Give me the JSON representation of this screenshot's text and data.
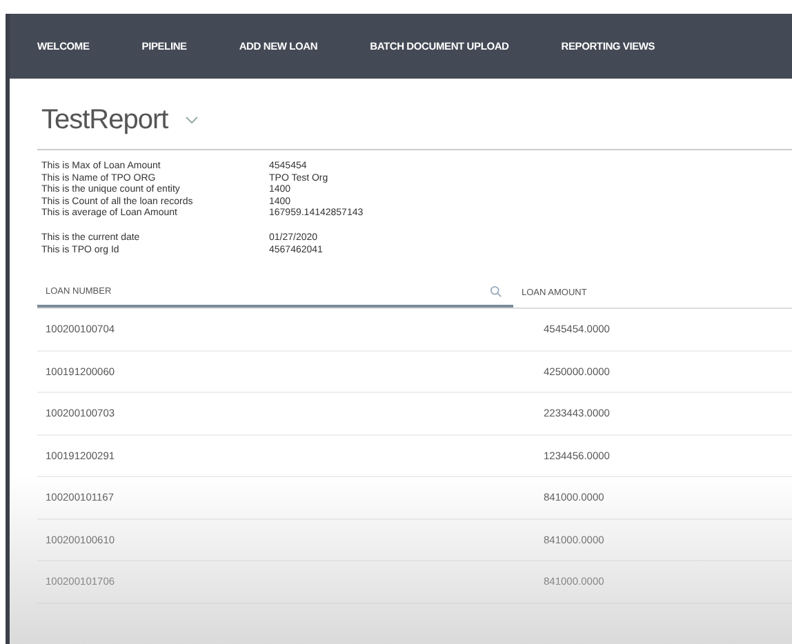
{
  "nav": [
    {
      "label": "WELCOME"
    },
    {
      "label": "PIPELINE"
    },
    {
      "label": "ADD NEW LOAN"
    },
    {
      "label": "BATCH DOCUMENT UPLOAD"
    },
    {
      "label": "REPORTING VIEWS"
    }
  ],
  "report": {
    "title": "TestReport"
  },
  "summary_groups": [
    [
      {
        "label": "This is Max of Loan Amount",
        "value": "4545454"
      },
      {
        "label": "This is Name of TPO ORG",
        "value": "TPO Test Org"
      },
      {
        "label": "This is the unique count of entity",
        "value": "1400"
      },
      {
        "label": "This is Count of all the loan records",
        "value": "1400"
      },
      {
        "label": "This is average of Loan Amount",
        "value": "167959.14142857143"
      }
    ],
    [
      {
        "label": "This is the current date",
        "value": "01/27/2020"
      },
      {
        "label": "This is TPO org Id",
        "value": "4567462041"
      }
    ]
  ],
  "table": {
    "columns": [
      "LOAN NUMBER",
      "LOAN AMOUNT"
    ],
    "rows": [
      [
        "100200100704",
        "4545454.0000"
      ],
      [
        "100191200060",
        "4250000.0000"
      ],
      [
        "100200100703",
        "2233443.0000"
      ],
      [
        "100191200291",
        "1234456.0000"
      ],
      [
        "100200101167",
        "841000.0000"
      ],
      [
        "100200100610",
        "841000.0000"
      ],
      [
        "100200101706",
        "841000.0000"
      ]
    ]
  }
}
